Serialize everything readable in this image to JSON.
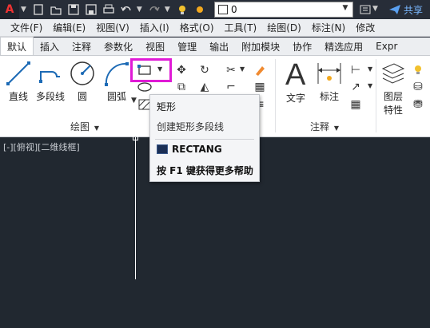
{
  "quick_access": {
    "layer_value": "0",
    "share_label": "共享"
  },
  "menubar": {
    "items": [
      "文件(F)",
      "编辑(E)",
      "视图(V)",
      "插入(I)",
      "格式(O)",
      "工具(T)",
      "绘图(D)",
      "标注(N)",
      "修改"
    ]
  },
  "ribbon_tabs": {
    "items": [
      "默认",
      "插入",
      "注释",
      "参数化",
      "视图",
      "管理",
      "输出",
      "附加模块",
      "协作",
      "精选应用",
      "Expr"
    ],
    "active": "默认"
  },
  "draw_panel": {
    "line": "直线",
    "polyline": "多段线",
    "circle": "圆",
    "arc": "圆弧",
    "panel_label": "绘图"
  },
  "annotation_panel": {
    "text": "文字",
    "dimension": "标注",
    "panel_label": "注释"
  },
  "layers_panel": {
    "layer_props_line1": "图层",
    "layer_props_line2": "特性"
  },
  "viewport": {
    "label": "[-][俯视][二维线框]"
  },
  "tooltip": {
    "title": "矩形",
    "description": "创建矩形多段线",
    "command": "RECTANG",
    "help": "按 F1 键获得更多帮助"
  },
  "colors": {
    "highlight": "#e01ad6",
    "canvas": "#212830",
    "share": "#7ab8ff"
  }
}
